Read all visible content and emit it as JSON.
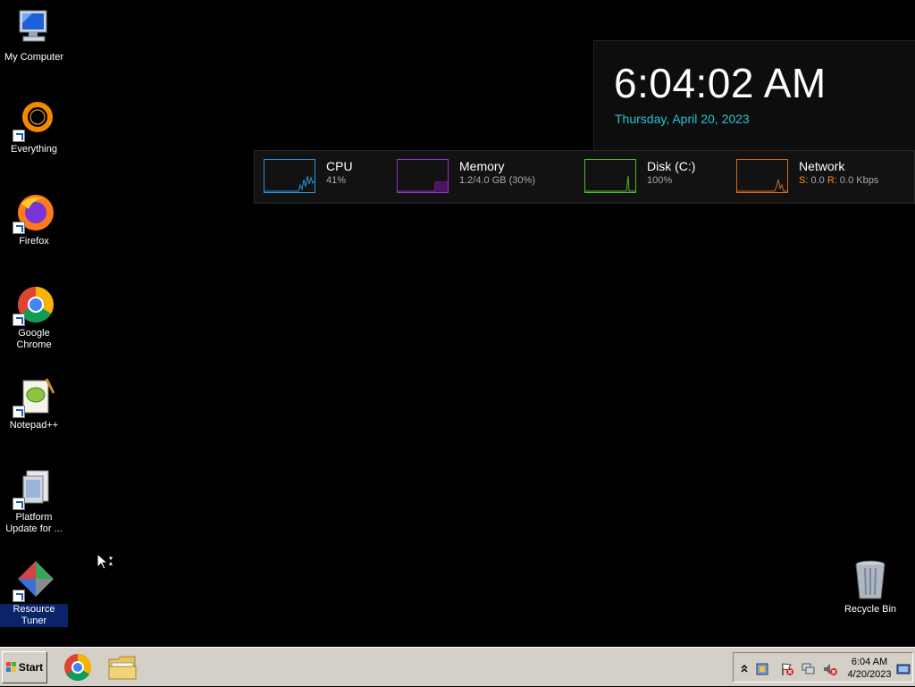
{
  "desktop": {
    "icons": [
      {
        "label": "My Computer",
        "icon": "computer-icon"
      },
      {
        "label": "Everything",
        "icon": "everything-icon"
      },
      {
        "label": "Firefox",
        "icon": "firefox-icon"
      },
      {
        "label": "Google Chrome",
        "icon": "chrome-icon"
      },
      {
        "label": "Notepad++",
        "icon": "notepadpp-icon"
      },
      {
        "label": "Platform Update for ...",
        "icon": "installer-icon"
      },
      {
        "label": "Resource Tuner",
        "icon": "resource-tuner-icon"
      },
      {
        "label": "Recycle Bin",
        "icon": "recycle-bin-icon"
      }
    ]
  },
  "clock": {
    "time": "6:04:02 AM",
    "date": "Thursday, April 20, 2023"
  },
  "resources": {
    "cpu": {
      "name": "CPU",
      "value": "41%",
      "color": "#2a8fd6"
    },
    "memory": {
      "name": "Memory",
      "value": "1.2/4.0 GB (30%)",
      "color": "#9b2fc7"
    },
    "disk": {
      "name": "Disk (C:)",
      "value": "100%",
      "color": "#4cb82f"
    },
    "network": {
      "name": "Network",
      "s_label": "S:",
      "s_value": "0.0",
      "r_label": "R:",
      "r_value": "0.0 Kbps",
      "color": "#d06a1a"
    }
  },
  "taskbar": {
    "start_label": "Start",
    "pinned": [
      "chrome-icon",
      "explorer-folder-icon"
    ],
    "tray_time": "6:04 AM",
    "tray_date": "4/20/2023"
  }
}
